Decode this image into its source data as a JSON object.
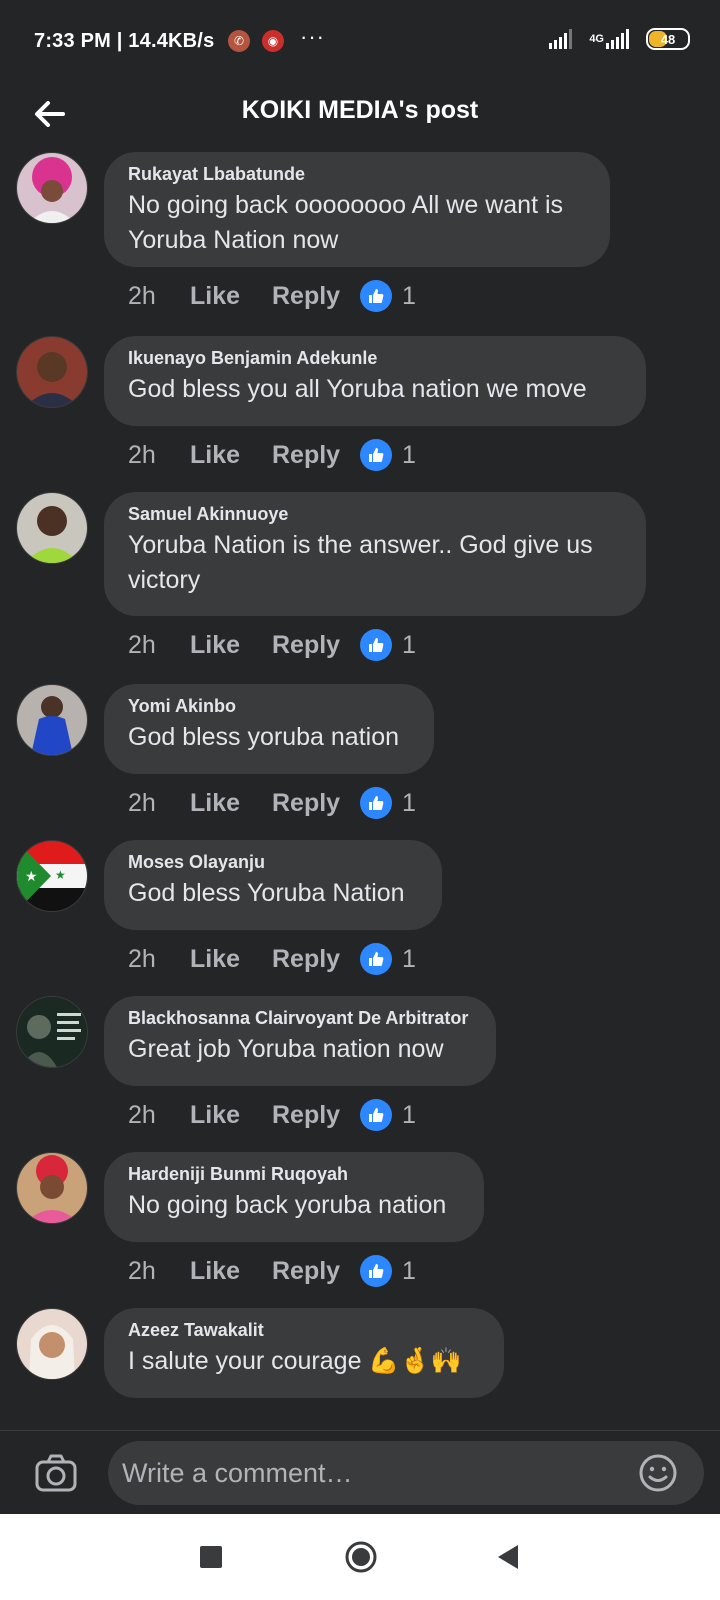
{
  "status_bar": {
    "time": "7:33 PM | 14.4KB/s",
    "network_type": "4G",
    "battery_level": "48",
    "more": "···"
  },
  "header": {
    "title": "KOIKI MEDIA's post"
  },
  "comments": [
    {
      "author": "Rukayat Lbabatunde",
      "text": "No going back oooooooo All we want is Yoruba Nation now",
      "time": "2h",
      "like_label": "Like",
      "reply_label": "Reply",
      "reaction_count": "1"
    },
    {
      "author": "Ikuenayo Benjamin Adekunle",
      "text": "God bless you all Yoruba nation we move",
      "time": "2h",
      "like_label": "Like",
      "reply_label": "Reply",
      "reaction_count": "1"
    },
    {
      "author": "Samuel Akinnuoye",
      "text": "Yoruba Nation is the answer.. God give us victory",
      "time": "2h",
      "like_label": "Like",
      "reply_label": "Reply",
      "reaction_count": "1"
    },
    {
      "author": "Yomi Akinbo",
      "text": "God bless yoruba nation",
      "time": "2h",
      "like_label": "Like",
      "reply_label": "Reply",
      "reaction_count": "1"
    },
    {
      "author": "Moses Olayanju",
      "text": "God bless Yoruba Nation",
      "time": "2h",
      "like_label": "Like",
      "reply_label": "Reply",
      "reaction_count": "1"
    },
    {
      "author": "Blackhosanna Clairvoyant De Arbitrator",
      "text": "Great job Yoruba nation now",
      "time": "2h",
      "like_label": "Like",
      "reply_label": "Reply",
      "reaction_count": "1"
    },
    {
      "author": "Hardeniji Bunmi Ruqoyah",
      "text": "No going back yoruba nation",
      "time": "2h",
      "like_label": "Like",
      "reply_label": "Reply",
      "reaction_count": "1"
    },
    {
      "author": "Azeez Tawakalit",
      "text": "I salute your courage 💪🤞🙌"
    }
  ],
  "composer": {
    "placeholder": "Write a comment…"
  },
  "colors": {
    "background": "#242526",
    "bubble": "#3a3b3c",
    "accent": "#2d88ff",
    "secondary_text": "#b0b3b8"
  },
  "icons": {
    "back": "arrow-left-icon",
    "reaction": "like-thumb-icon",
    "camera": "camera-icon",
    "emoji": "smiley-icon"
  }
}
